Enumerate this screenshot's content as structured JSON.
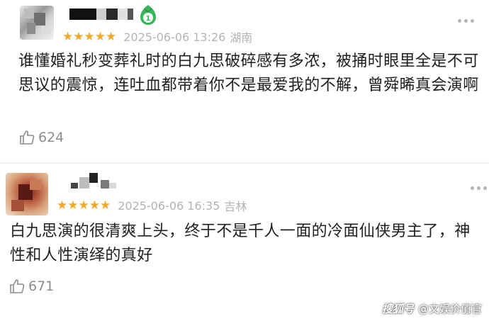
{
  "comments": [
    {
      "text": "谁懂婚礼秒变葬礼时的白九思破碎感有多浓，被捅时眼里全是不可思议的震惊，连吐血都带着你不是最爱我的不解，曾舜晞真会演啊",
      "stars": "★★★★★",
      "date": "2025-06-06 13:26",
      "location": "湖南",
      "likes": "624",
      "level": "1"
    },
    {
      "text": "白九思演的很清爽上头，终于不是千人一面的冷面仙侠男主了，神性和人性演绎的真好",
      "stars": "★★★★★",
      "date": "2025-06-06 16:35",
      "location": "吉林",
      "likes": "671"
    }
  ],
  "watermark": {
    "mark": "搜狐号",
    "account": "@文娱价值官"
  },
  "colors": {
    "star": "#f5a623",
    "meta": "#b3b3b3",
    "text": "#1f1f1f",
    "badge": "#3bb55a"
  }
}
